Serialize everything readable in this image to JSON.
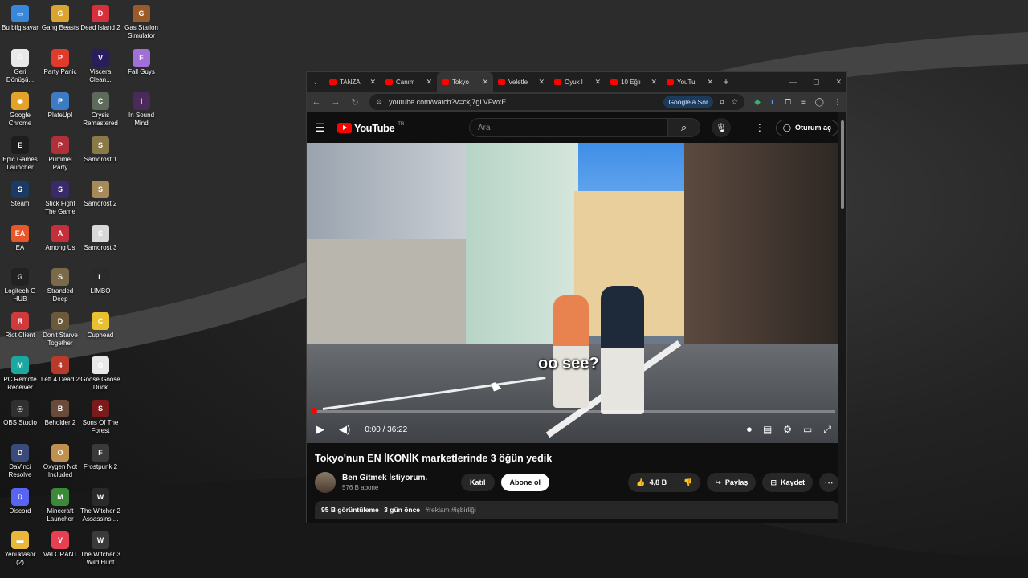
{
  "desktop": {
    "icons": [
      {
        "label": "Bu bilgisayar",
        "color": "#3a86d8",
        "glyph": "▭"
      },
      {
        "label": "Gang Beasts",
        "color": "#d9a531",
        "glyph": "G"
      },
      {
        "label": "Dead Island 2",
        "color": "#d6303a",
        "glyph": "D"
      },
      {
        "label": "Gas Station Simulator",
        "color": "#9a5a2a",
        "glyph": "G"
      },
      {
        "label": "Geri Dönüşü...",
        "color": "#e8e8e8",
        "glyph": "♻"
      },
      {
        "label": "Party Panic",
        "color": "#e03a2c",
        "glyph": "P"
      },
      {
        "label": "Viscera Clean...",
        "color": "#2a1d5c",
        "glyph": "V"
      },
      {
        "label": "Fall Guys",
        "color": "#a070d8",
        "glyph": "F"
      },
      {
        "label": "Google Chrome",
        "color": "#e3a32a",
        "glyph": "◉"
      },
      {
        "label": "PlateUp!",
        "color": "#3d7cc4",
        "glyph": "P"
      },
      {
        "label": "Crysis Remastered",
        "color": "#5e6a5a",
        "glyph": "C"
      },
      {
        "label": "In Sound Mind",
        "color": "#4a2a5a",
        "glyph": "I"
      },
      {
        "label": "Epic Games Launcher",
        "color": "#1d1d1d",
        "glyph": "E"
      },
      {
        "label": "Pummel Party",
        "color": "#b0303a",
        "glyph": "P"
      },
      {
        "label": "Samorost 1",
        "color": "#8a7a4a",
        "glyph": "S"
      },
      {
        "label": "Steam",
        "color": "#1b3a64",
        "glyph": "S"
      },
      {
        "label": "Stick Fight The Game",
        "color": "#3a2a6a",
        "glyph": "S"
      },
      {
        "label": "Samorost 2",
        "color": "#a68a5a",
        "glyph": "S"
      },
      {
        "label": "EA",
        "color": "#e8562a",
        "glyph": "EA"
      },
      {
        "label": "Among Us",
        "color": "#c4303a",
        "glyph": "A"
      },
      {
        "label": "Samorost 3",
        "color": "#d8d8d8",
        "glyph": "S"
      },
      {
        "label": "Logitech G HUB",
        "color": "#222",
        "glyph": "G"
      },
      {
        "label": "Stranded Deep",
        "color": "#7a6a4a",
        "glyph": "S"
      },
      {
        "label": "LIMBO",
        "color": "#2a2a2a",
        "glyph": "L"
      },
      {
        "label": "Riot Client",
        "color": "#d03a3a",
        "glyph": "R"
      },
      {
        "label": "Don't Starve Together",
        "color": "#6a5a3a",
        "glyph": "D"
      },
      {
        "label": "Cuphead",
        "color": "#e8c030",
        "glyph": "C"
      },
      {
        "label": "PC Remote Receiver",
        "color": "#1aa8a0",
        "glyph": "M"
      },
      {
        "label": "Left 4 Dead 2",
        "color": "#b83a2a",
        "glyph": "4"
      },
      {
        "label": "Goose Goose Duck",
        "color": "#e8e8e8",
        "glyph": "G"
      },
      {
        "label": "OBS Studio",
        "color": "#303030",
        "glyph": "◎"
      },
      {
        "label": "Beholder 2",
        "color": "#6a4a3a",
        "glyph": "B"
      },
      {
        "label": "Sons Of The Forest",
        "color": "#7a1a1a",
        "glyph": "S"
      },
      {
        "label": "DaVinci Resolve",
        "color": "#3a4a7a",
        "glyph": "D"
      },
      {
        "label": "Oxygen Not Included",
        "color": "#c09050",
        "glyph": "O"
      },
      {
        "label": "Frostpunk 2",
        "color": "#3a3a3a",
        "glyph": "F"
      },
      {
        "label": "Discord",
        "color": "#5865f2",
        "glyph": "D"
      },
      {
        "label": "Minecraft Launcher",
        "color": "#3a8a3a",
        "glyph": "M"
      },
      {
        "label": "The Witcher 2 Assassins ...",
        "color": "#2a2a2a",
        "glyph": "W"
      },
      {
        "label": "Yeni klasör (2)",
        "color": "#e8b83a",
        "glyph": "▬"
      },
      {
        "label": "VALORANT",
        "color": "#e84050",
        "glyph": "V"
      },
      {
        "label": "The Witcher 3 Wild Hunt",
        "color": "#3a3a3a",
        "glyph": "W"
      }
    ]
  },
  "browser": {
    "tabs": [
      {
        "title": "TANZA",
        "active": false
      },
      {
        "title": "Canım",
        "active": false
      },
      {
        "title": "Tokyo",
        "active": true
      },
      {
        "title": "Veletle",
        "active": false
      },
      {
        "title": "Oyuk l",
        "active": false
      },
      {
        "title": "10 Eğlı",
        "active": false
      },
      {
        "title": "YouTu",
        "active": false
      }
    ],
    "url": "youtube.com/watch?v=ckj7gLVFwxE",
    "google_ask": "Google'a Sor"
  },
  "youtube": {
    "logo": "YouTube",
    "logo_sup": "TR",
    "search_placeholder": "Ara",
    "signin": "Oturum aç",
    "caption": "oo see?",
    "time": "0:00 / 36:22",
    "progress": 0.0,
    "title": "Tokyo'nun EN İKONİK marketlerinde 3 öğün yedik",
    "channel": "Ben Gitmek İstiyorum.",
    "subs": "576 B abone",
    "join": "Katıl",
    "subscribe": "Abone ol",
    "likes": "4,8 B",
    "share": "Paylaş",
    "save": "Kaydet",
    "views": "95 B görüntüleme",
    "age": "3 gün önce",
    "tags": "#reklam #işbirliği"
  }
}
